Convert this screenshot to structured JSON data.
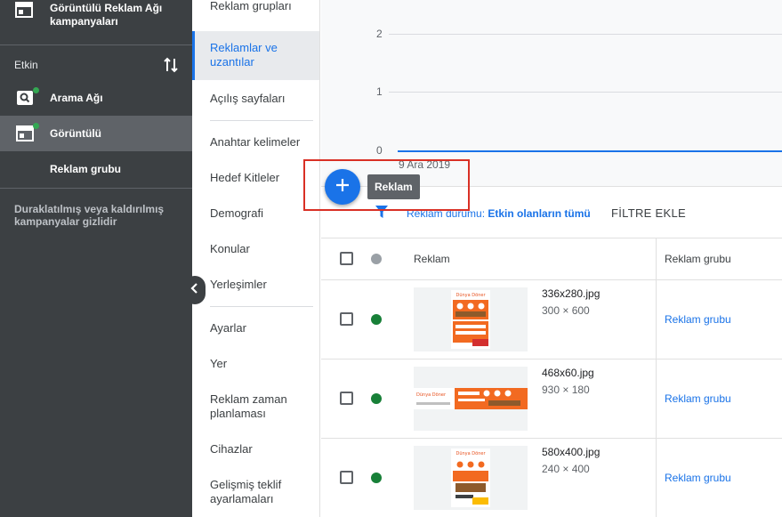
{
  "sidebar": {
    "campaign_label": "Görüntülü Reklam Ağı kampanyaları",
    "section_label": "Etkin",
    "items": [
      {
        "label": "Arama Ağı",
        "icon": "search-campaign-icon"
      },
      {
        "label": "Görüntülü",
        "icon": "display-campaign-icon"
      },
      {
        "label": "Reklam grubu"
      }
    ],
    "note": "Duraklatılmış veya kaldırılmış kampanyalar gizlidir"
  },
  "subnav": {
    "items": [
      "Reklam grupları",
      "Reklamlar ve uzantılar",
      "Açılış sayfaları",
      "Anahtar kelimeler",
      "Hedef Kitleler",
      "Demografi",
      "Konular",
      "Yerleşimler",
      "Ayarlar",
      "Yer",
      "Reklam zaman planlaması",
      "Cihazlar",
      "Gelişmiş teklif ayarlamaları"
    ]
  },
  "chart": {
    "ticks": [
      "2",
      "1",
      "0"
    ],
    "x_label": "9 Ara 2019"
  },
  "chart_data": {
    "type": "line",
    "x": [
      "9 Ara 2019"
    ],
    "series": [
      {
        "values": [
          0
        ]
      }
    ],
    "ylim": [
      0,
      2
    ],
    "grid": true
  },
  "fab": {
    "tooltip": "Reklam"
  },
  "filter": {
    "prefix": "Reklam durumu: ",
    "value": "Etkin olanların tümü",
    "add_label": "FİLTRE EKLE"
  },
  "table": {
    "headers": {
      "ad": "Reklam",
      "ad_group": "Reklam grubu"
    },
    "rows": [
      {
        "file": "336x280.jpg",
        "size": "300 × 600",
        "group": "Reklam grubu",
        "status": "active"
      },
      {
        "file": "468x60.jpg",
        "size": "930 × 180",
        "group": "Reklam grubu",
        "status": "active"
      },
      {
        "file": "580x400.jpg",
        "size": "240 × 400",
        "group": "Reklam grubu",
        "status": "active"
      }
    ]
  },
  "colors": {
    "sidebar_bg": "#3c4043",
    "accent_blue": "#1a73e8",
    "status_green": "#188038",
    "highlight_red": "#d93025",
    "ad_orange": "#f26a21"
  }
}
